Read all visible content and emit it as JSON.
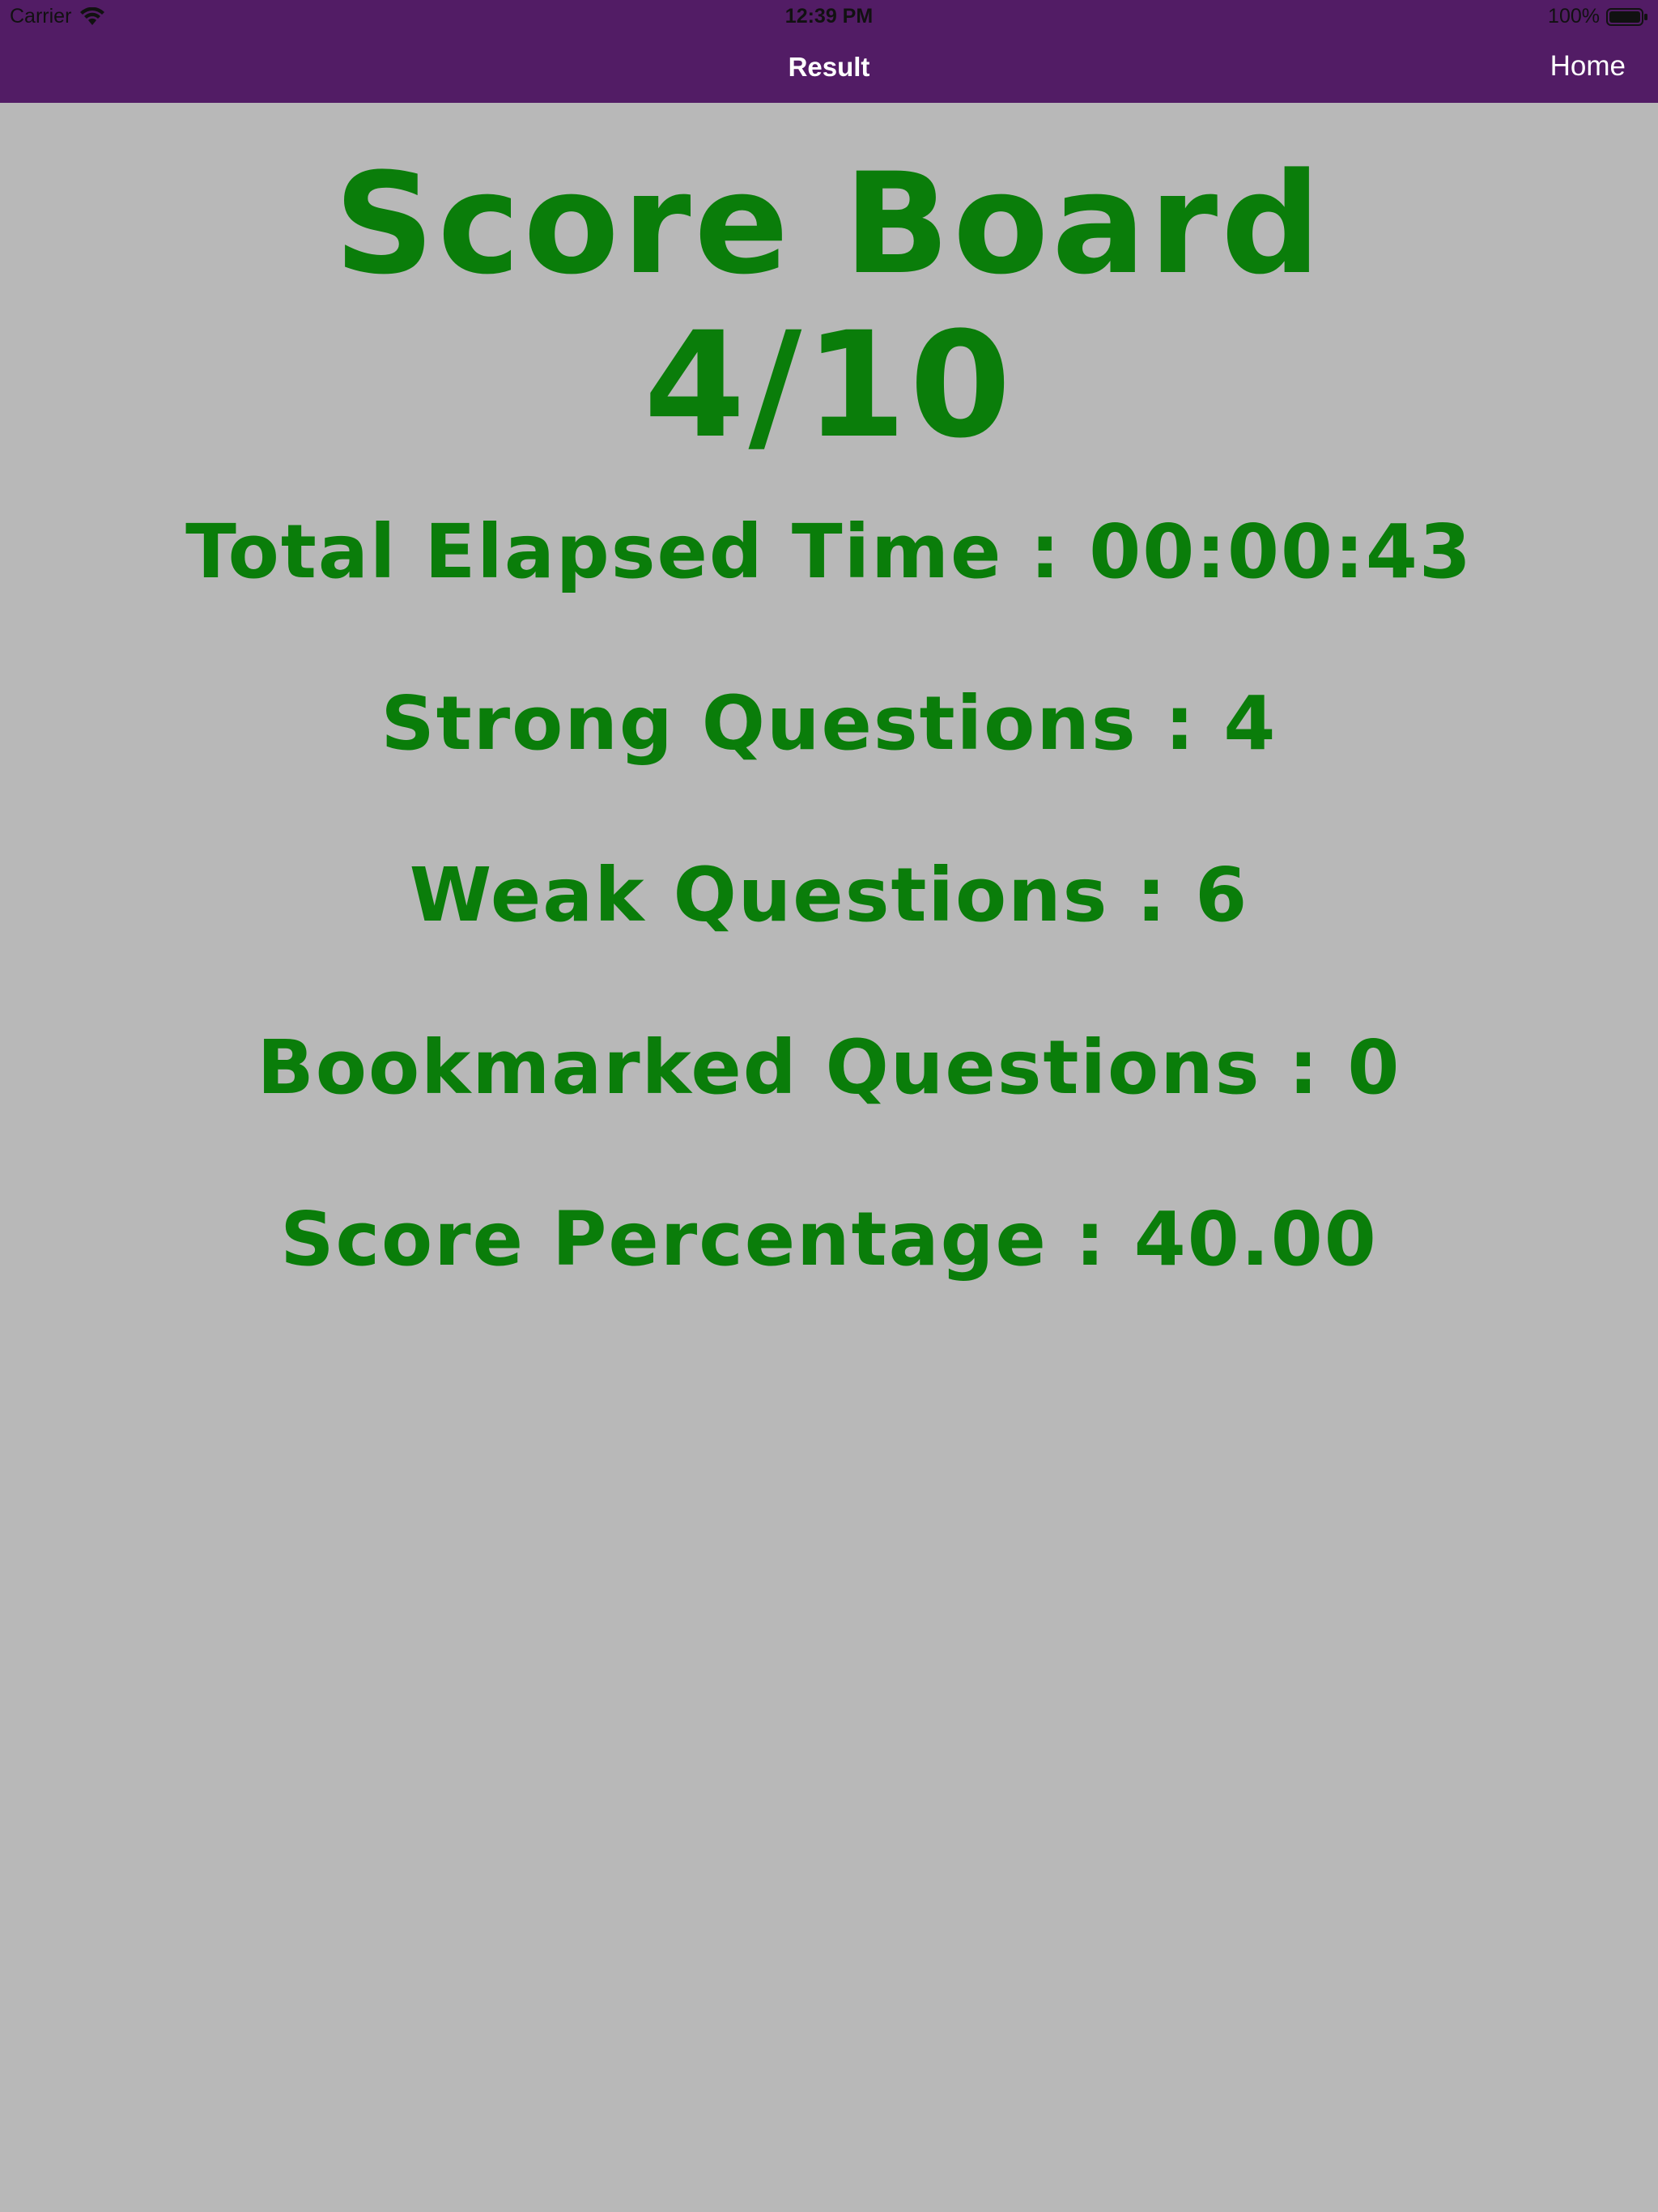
{
  "status_bar": {
    "carrier": "Carrier",
    "time": "12:39 PM",
    "battery": "100%"
  },
  "nav": {
    "title": "Result",
    "home_label": "Home"
  },
  "score_board": {
    "title": "Score Board",
    "score": "4/10",
    "elapsed_time": "Total Elapsed Time : 00:00:43",
    "strong_questions": "Strong Questions : 4",
    "weak_questions": "Weak Questions : 6",
    "bookmarked_questions": "Bookmarked Questions : 0",
    "score_percentage": "Score Percentage : 40.00"
  },
  "colors": {
    "nav_background": "#521c65",
    "page_background": "#b8b8b8",
    "score_text": "#0a7d0a"
  }
}
